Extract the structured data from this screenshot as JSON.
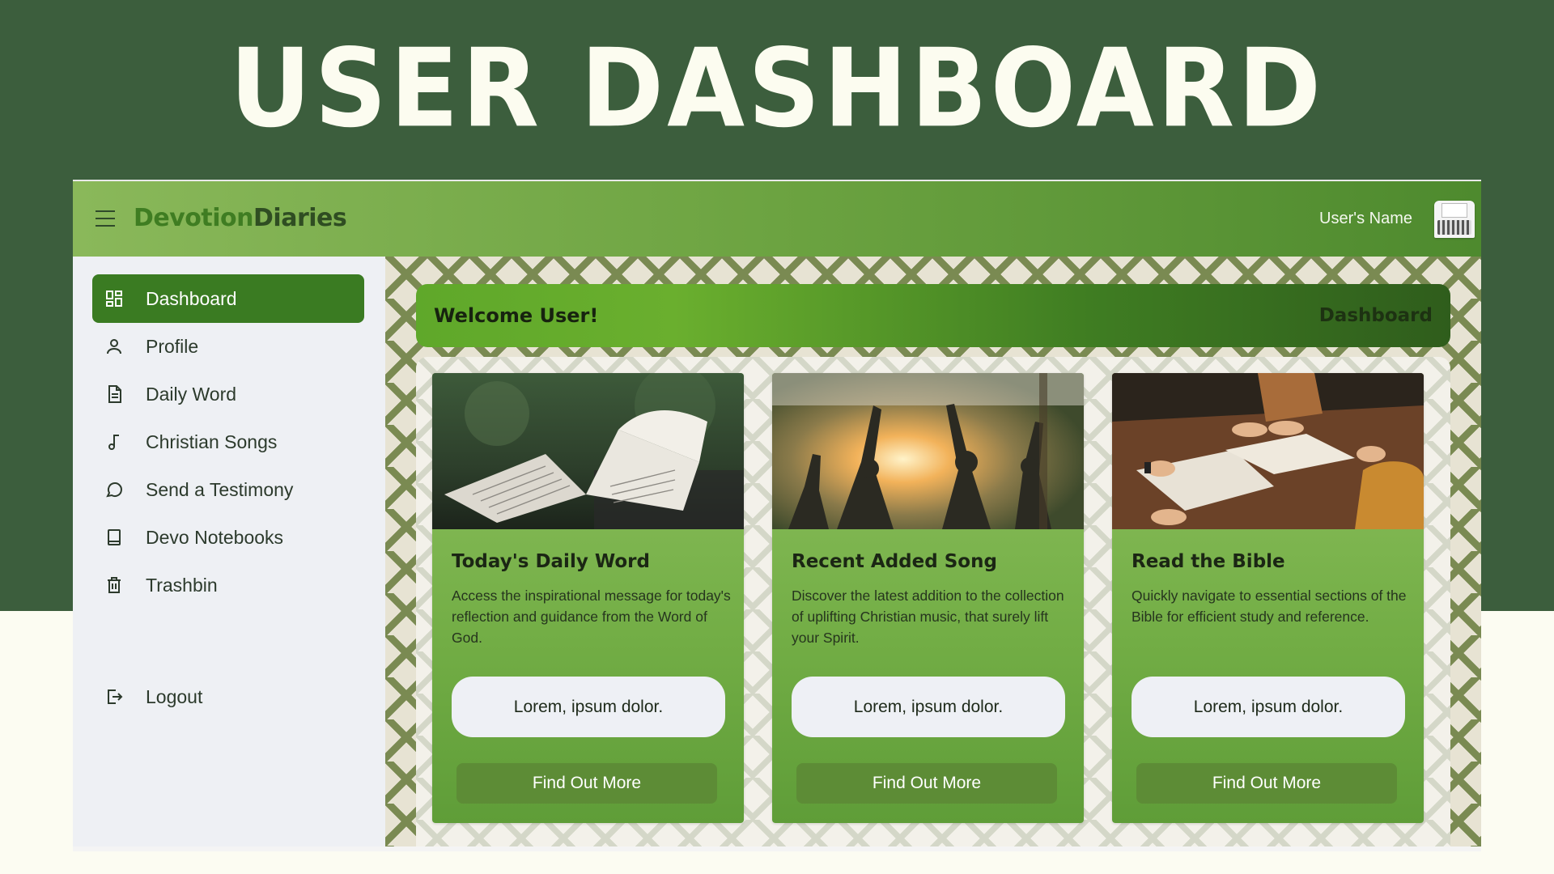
{
  "poster": {
    "title": "USER DASHBOARD"
  },
  "navbar": {
    "brand_part1": "Devotion",
    "brand_part2": "Diaries",
    "user_name": "User's Name"
  },
  "sidebar": {
    "items": [
      {
        "label": "Dashboard",
        "icon": "dashboard-icon",
        "active": true
      },
      {
        "label": "Profile",
        "icon": "user-icon"
      },
      {
        "label": "Daily Word",
        "icon": "document-icon"
      },
      {
        "label": "Christian Songs",
        "icon": "music-note-icon"
      },
      {
        "label": "Send a Testimony",
        "icon": "chat-bubble-icon"
      },
      {
        "label": "Devo Notebooks",
        "icon": "notebook-icon"
      },
      {
        "label": "Trashbin",
        "icon": "trash-icon"
      }
    ],
    "logout": {
      "label": "Logout",
      "icon": "logout-icon"
    }
  },
  "main": {
    "welcome": "Welcome User!",
    "breadcrumb": "Dashboard",
    "cards": [
      {
        "title": "Today's Daily Word",
        "description": "Access the inspirational message for today's reflection and guidance from the Word of God.",
        "pill": "Lorem, ipsum dolor.",
        "button": "Find Out More",
        "image": "open-bible-photo"
      },
      {
        "title": "Recent Added Song",
        "description": "Discover the latest addition to the collection of uplifting Christian music, that surely lift your Spirit.",
        "pill": "Lorem, ipsum dolor.",
        "button": "Find Out More",
        "image": "worship-crowd-photo"
      },
      {
        "title": "Read the Bible",
        "description": "Quickly navigate to essential sections of the Bible for efficient study and reference.",
        "pill": "Lorem, ipsum dolor.",
        "button": "Find Out More",
        "image": "bible-study-photo"
      }
    ]
  },
  "colors": {
    "poster_bg": "#3c5e3d",
    "navbar_green": "#6ca341",
    "active_item": "#3a7b22",
    "card_button": "#5d8c36"
  }
}
